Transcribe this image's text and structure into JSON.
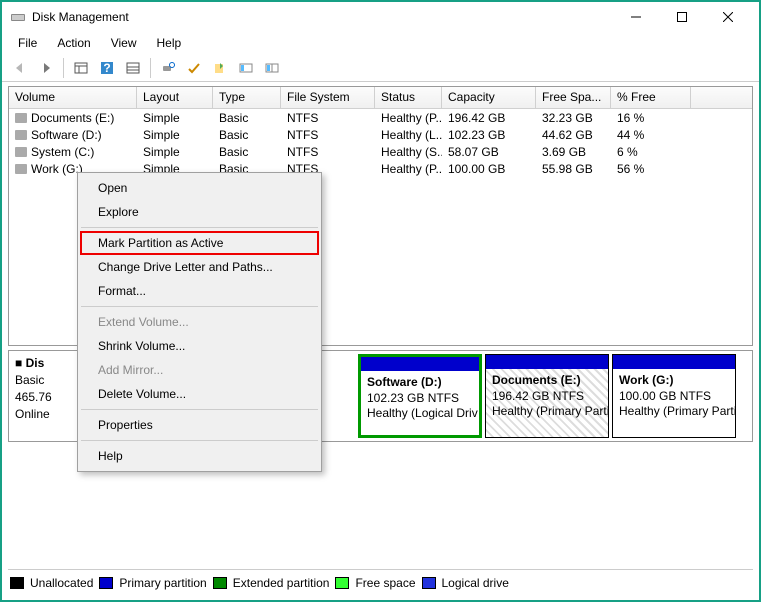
{
  "window": {
    "title": "Disk Management"
  },
  "menubar": {
    "items": [
      "File",
      "Action",
      "View",
      "Help"
    ]
  },
  "volumes": {
    "columns": [
      "Volume",
      "Layout",
      "Type",
      "File System",
      "Status",
      "Capacity",
      "Free Spa...",
      "% Free"
    ],
    "rows": [
      {
        "name": "Documents (E:)",
        "layout": "Simple",
        "type": "Basic",
        "fs": "NTFS",
        "status": "Healthy (P...",
        "cap": "196.42 GB",
        "free": "32.23 GB",
        "pct": "16 %"
      },
      {
        "name": "Software (D:)",
        "layout": "Simple",
        "type": "Basic",
        "fs": "NTFS",
        "status": "Healthy (L...",
        "cap": "102.23 GB",
        "free": "44.62 GB",
        "pct": "44 %"
      },
      {
        "name": "System (C:)",
        "layout": "Simple",
        "type": "Basic",
        "fs": "NTFS",
        "status": "Healthy (S...",
        "cap": "58.07 GB",
        "free": "3.69 GB",
        "pct": "6 %"
      },
      {
        "name": "Work (G:)",
        "layout": "Simple",
        "type": "Basic",
        "fs": "NTFS",
        "status": "Healthy (P...",
        "cap": "100.00 GB",
        "free": "55.98 GB",
        "pct": "56 %"
      }
    ]
  },
  "disk": {
    "label_prefix": "Dis",
    "type": "Basic",
    "size": "465.76",
    "status": "Online",
    "parts": {
      "software": {
        "title": "Software  (D:)",
        "line2": "102.23 GB NTFS",
        "line3": "Healthy (Logical Driv"
      },
      "documents": {
        "title": "Documents  (E:)",
        "line2": "196.42 GB NTFS",
        "line3": "Healthy (Primary Partitio"
      },
      "work": {
        "title": "Work  (G:)",
        "line2": "100.00 GB NTFS",
        "line3": "Healthy (Primary Partit"
      }
    }
  },
  "legend": {
    "unallocated": "Unallocated",
    "primary": "Primary partition",
    "extended": "Extended partition",
    "free": "Free space",
    "logical": "Logical drive"
  },
  "context": {
    "open": "Open",
    "explore": "Explore",
    "mark_active": "Mark Partition as Active",
    "change_letter": "Change Drive Letter and Paths...",
    "format": "Format...",
    "extend": "Extend Volume...",
    "shrink": "Shrink Volume...",
    "add_mirror": "Add Mirror...",
    "delete": "Delete Volume...",
    "properties": "Properties",
    "help": "Help"
  }
}
